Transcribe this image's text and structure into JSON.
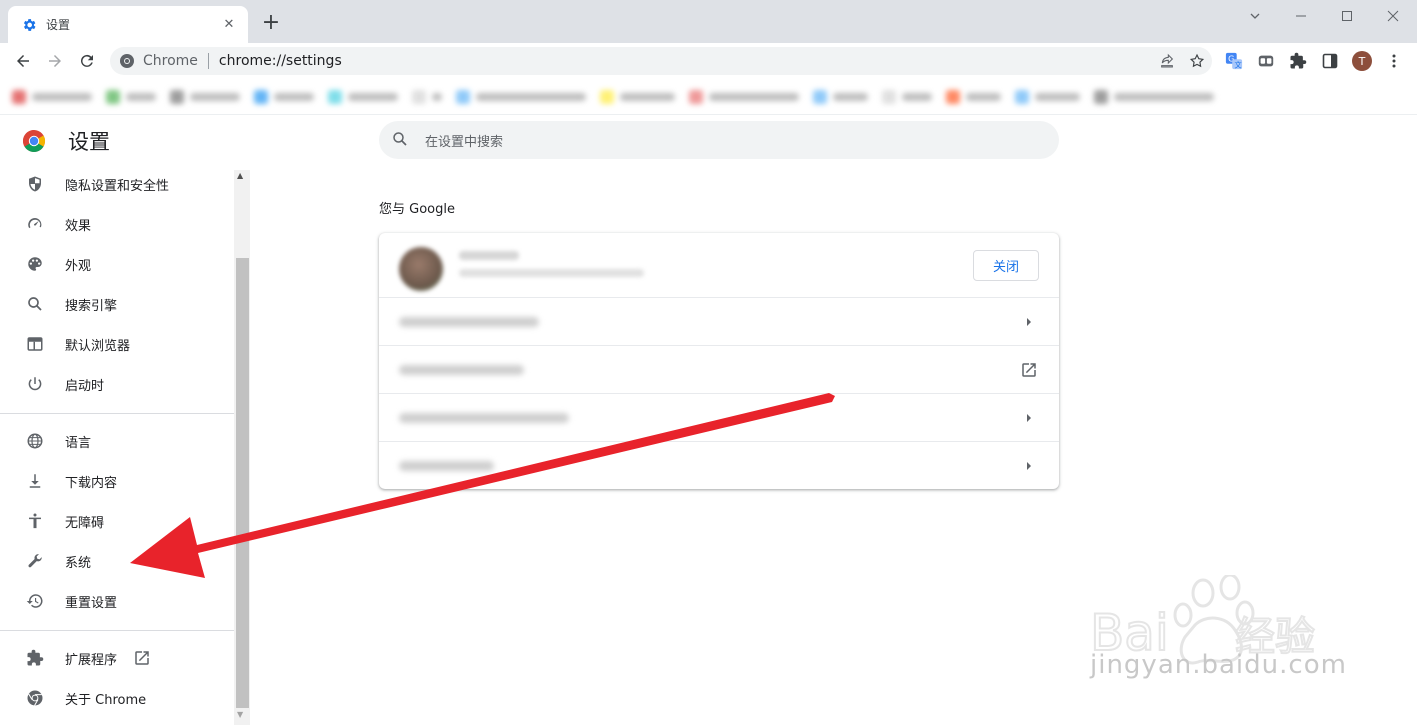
{
  "browser": {
    "tab_title": "设置",
    "new_tab": "+",
    "omnibox_chip": "Chrome",
    "url": "chrome://settings",
    "avatar_letter": "T"
  },
  "header": {
    "title": "设置"
  },
  "sidebar": {
    "items": [
      {
        "label": "隐私设置和安全性",
        "icon": "shield-icon"
      },
      {
        "label": "效果",
        "icon": "speedometer-icon"
      },
      {
        "label": "外观",
        "icon": "palette-icon"
      },
      {
        "label": "搜索引擎",
        "icon": "search-icon"
      },
      {
        "label": "默认浏览器",
        "icon": "browser-window-icon"
      },
      {
        "label": "启动时",
        "icon": "power-icon"
      },
      {
        "label": "语言",
        "icon": "globe-icon"
      },
      {
        "label": "下载内容",
        "icon": "download-icon"
      },
      {
        "label": "无障碍",
        "icon": "accessibility-icon"
      },
      {
        "label": "系统",
        "icon": "wrench-icon"
      },
      {
        "label": "重置设置",
        "icon": "restore-icon"
      },
      {
        "label": "扩展程序",
        "icon": "puzzle-icon"
      },
      {
        "label": "关于 Chrome",
        "icon": "chrome-icon"
      }
    ]
  },
  "main": {
    "search_placeholder": "在设置中搜索",
    "section_title": "您与 Google",
    "close_label": "关闭"
  },
  "watermark": {
    "text": "jingyan.baidu.com"
  },
  "colors": {
    "accent": "#1a73e8",
    "arrow": "#e8232b"
  }
}
